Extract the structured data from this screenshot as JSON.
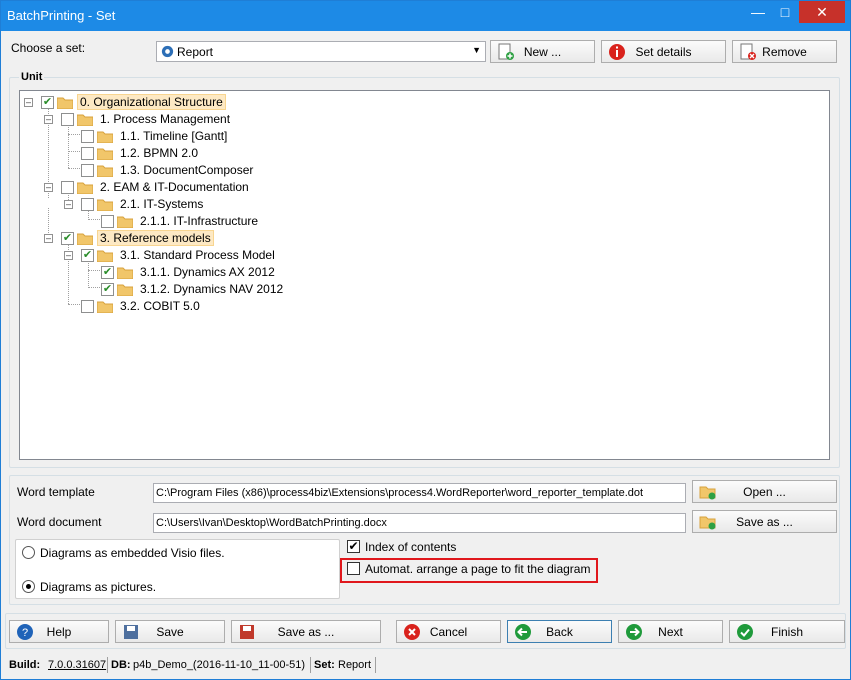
{
  "window": {
    "title": "BatchPrinting - Set"
  },
  "set_row": {
    "label": "Choose a set:",
    "selected": "Report",
    "new_label": "New ...",
    "details_label": "Set details",
    "remove_label": "Remove"
  },
  "unit": {
    "title": "Unit",
    "nodes": [
      {
        "label": "0. Organizational Structure",
        "checked": true,
        "selected": true
      },
      {
        "label": "1. Process Management",
        "checked": false
      },
      {
        "label": "1.1. Timeline [Gantt]",
        "checked": false
      },
      {
        "label": "1.2. BPMN 2.0",
        "checked": false
      },
      {
        "label": "1.3. DocumentComposer",
        "checked": false
      },
      {
        "label": "2. EAM & IT-Documentation",
        "checked": false
      },
      {
        "label": "2.1. IT-Systems",
        "checked": false
      },
      {
        "label": "2.1.1. IT-Infrastructure",
        "checked": false
      },
      {
        "label": "3. Reference models",
        "checked": true,
        "selected": true
      },
      {
        "label": "3.1. Standard Process Model",
        "checked": true
      },
      {
        "label": "3.1.1. Dynamics AX 2012",
        "checked": true
      },
      {
        "label": "3.1.2. Dynamics NAV 2012",
        "checked": true
      },
      {
        "label": "3.2. COBIT 5.0",
        "checked": false
      }
    ]
  },
  "output": {
    "template_label": "Word template",
    "template_value": "C:\\Program Files (x86)\\process4biz\\Extensions\\process4.WordReporter\\word_reporter_template.dot",
    "open_label": "Open ...",
    "document_label": "Word document",
    "document_value": "C:\\Users\\Ivan\\Desktop\\WordBatchPrinting.docx",
    "saveas_label": "Save as ...",
    "radio_embedded": "Diagrams as embedded Visio files.",
    "radio_pictures": "Diagrams as pictures.",
    "index_label": "Index of contents",
    "index_checked": true,
    "arrange_label": "Automat. arrange a page to fit the diagram",
    "arrange_checked": false
  },
  "buttons": {
    "help": "Help",
    "save": "Save",
    "save_as": "Save as ...",
    "cancel": "Cancel",
    "back": "Back",
    "next": "Next",
    "finish": "Finish"
  },
  "status": {
    "build_label": "Build:",
    "build_value": "7.0.0.31607",
    "db_label": "DB:",
    "db_value": "p4b_Demo_(2016-11-10_11-00-51)",
    "set_label": "Set:",
    "set_value": "Report"
  }
}
